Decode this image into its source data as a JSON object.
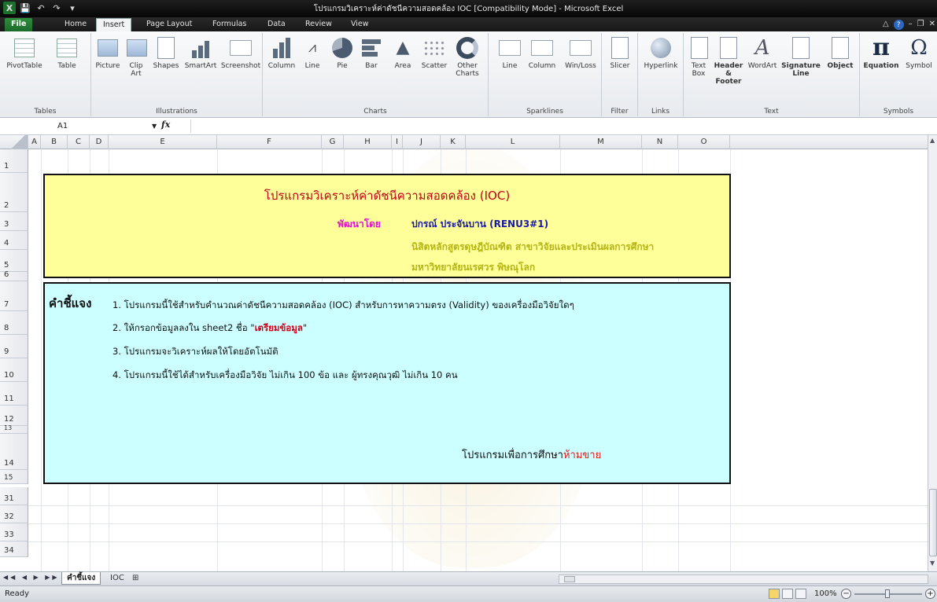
{
  "window": {
    "title": "โปรแกรมวิเคราะห์ค่าดัชนีความสอดคล้อง IOC  [Compatibility Mode]  -  Microsoft Excel",
    "logo": "X"
  },
  "tabs": [
    "File",
    "Home",
    "Insert",
    "Page Layout",
    "Formulas",
    "Data",
    "Review",
    "View"
  ],
  "active_tab": "Insert",
  "ribbon": {
    "groups": {
      "tables": "Tables",
      "illustrations": "Illustrations",
      "charts": "Charts",
      "sparklines": "Sparklines",
      "filter": "Filter",
      "links": "Links",
      "text": "Text",
      "symbols": "Symbols"
    },
    "buttons": {
      "pivottable": "PivotTable",
      "table": "Table",
      "picture": "Picture",
      "clip_art": "Clip Art",
      "shapes": "Shapes",
      "smartart": "SmartArt",
      "screenshot": "Screenshot",
      "column": "Column",
      "line": "Line",
      "pie": "Pie",
      "bar": "Bar",
      "area": "Area",
      "scatter": "Scatter",
      "other_charts": "Other Charts",
      "spark_line": "Line",
      "spark_column": "Column",
      "spark_winloss": "Win/Loss",
      "slicer": "Slicer",
      "hyperlink": "Hyperlink",
      "text_box": "Text Box",
      "header_footer": "Header & Footer",
      "wordart": "WordArt",
      "signature_line": "Signature Line",
      "object": "Object",
      "equation": "Equation",
      "symbol": "Symbol"
    }
  },
  "formula_bar": {
    "name_box": "A1",
    "fx": "fx",
    "value": ""
  },
  "columns": [
    "A",
    "B",
    "C",
    "D",
    "E",
    "F",
    "G",
    "H",
    "I",
    "J",
    "K",
    "L",
    "M",
    "N",
    "O"
  ],
  "rows": [
    "1",
    "2",
    "3",
    "4",
    "5",
    "6",
    "7",
    "8",
    "9",
    "10",
    "11",
    "12",
    "13",
    "14",
    "15",
    "31",
    "32",
    "33",
    "34"
  ],
  "header_box": {
    "title": "โปรแกรมวิเคราะห์ค่าดัชนีความสอดคล้อง (IOC)",
    "developed_by": "พัฒนาโดย",
    "author": "ปกรณ์  ประจันบาน (RENU3#1)",
    "line2": "นิสิตหลักสูตรดุษฎีบัณฑิต สาขาวิจัยและประเมินผลการศึกษา",
    "line3": "มหาวิทยาลัยนเรศวร พิษณุโลก"
  },
  "instructions": {
    "heading": "คำชี้แจง",
    "item1": "1. โปรแกรมนี้ใช้สำหรับคำนวณค่าดัชนีความสอดคล้อง (IOC) สำหรับการหาความตรง (Validity) ของเครื่องมือวิจัยใดๆ",
    "item2_prefix": "2. ให้กรอกข้อมูลลงใน sheet2 ชื่อ \"",
    "item2_highlight": "เตรียมข้อมูล",
    "item2_suffix": "\"",
    "item3": "3. โปรแกรมจะวิเคราะห์ผลให้โดยอัตโนมัติ",
    "item4": "4.  โปรแกรมนี้ใช้ได้สำหรับเครื่องมือวิจัย ไม่เกิน 100 ข้อ และ ผู้ทรงคุณวุฒิ ไม่เกิน 10 คน",
    "footer_prefix": "โปรแกรมเพื่อการศึกษา",
    "footer_highlight": "ห้ามขาย"
  },
  "sheets": [
    "คำชี้แจง",
    "IOC"
  ],
  "active_sheet": "คำชี้แจง",
  "status": {
    "ready": "Ready",
    "zoom": "100%",
    "zoom_level_percent": 100
  },
  "colors": {
    "yellow_box": "#ffff99",
    "cyan_box": "#ccffff",
    "title_red": "#c0001a",
    "excel_green": "#1d6f2e"
  }
}
